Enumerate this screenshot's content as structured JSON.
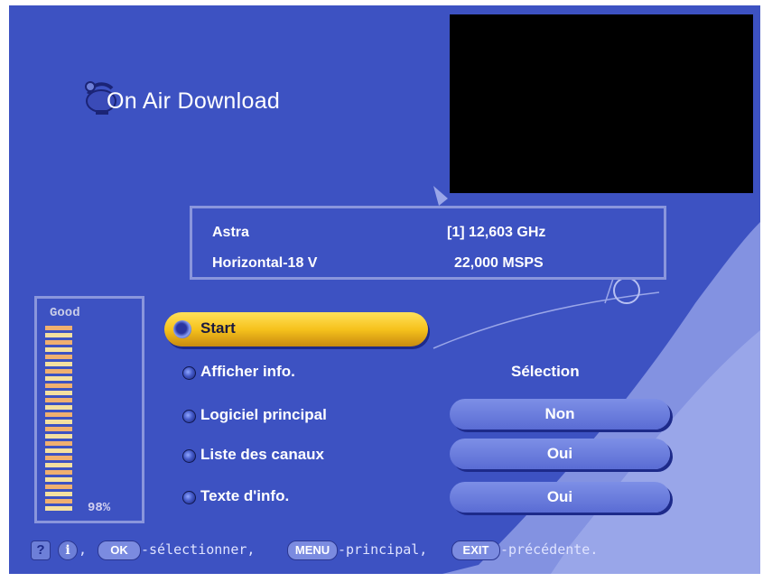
{
  "title": "On Air Download",
  "info": {
    "satellite": "Astra",
    "frequency": "[1] 12,603 GHz",
    "polarization": "Horizontal-18 V",
    "symbol_rate": "22,000 MSPS"
  },
  "signal": {
    "quality_label": "Good",
    "percent_label": "98%",
    "level": 0.98
  },
  "menu": {
    "start_label": "Start",
    "items": [
      {
        "label": "Afficher info.",
        "value": "Sélection"
      },
      {
        "label": "Logiciel principal",
        "value": "Non"
      },
      {
        "label": "Liste des canaux",
        "value": "Oui"
      },
      {
        "label": "Texte d'info.",
        "value": "Oui"
      }
    ]
  },
  "footer": {
    "help_key": "?",
    "info_key": "i",
    "ok_key": "OK",
    "ok_text": "-sélectionner,",
    "menu_key": "MENU",
    "menu_text": "-principal,",
    "exit_key": "EXIT",
    "exit_text": "-précédente.",
    "separator": ","
  },
  "colors": {
    "background": "#3d52c2",
    "highlight": "#f6c21c",
    "pill": "#6a7cdc",
    "border": "#8a96dc"
  },
  "icons": [
    "satellite-dish-icon",
    "help-icon",
    "info-icon"
  ]
}
